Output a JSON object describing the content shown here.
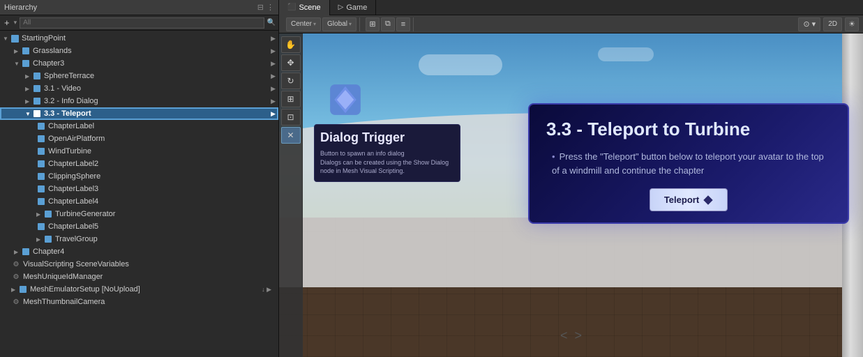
{
  "hierarchy": {
    "panel_title": "Hierarchy",
    "search_placeholder": "All",
    "tree": [
      {
        "id": "starting-point",
        "label": "StartingPoint",
        "level": 0,
        "expanded": true,
        "type": "root",
        "icon": "cube"
      },
      {
        "id": "grasslands",
        "label": "Grasslands",
        "level": 1,
        "expanded": false,
        "type": "cube",
        "icon": "cube"
      },
      {
        "id": "chapter3",
        "label": "Chapter3",
        "level": 1,
        "expanded": true,
        "type": "cube",
        "icon": "cube"
      },
      {
        "id": "sphere-terrace",
        "label": "SphereTerrace",
        "level": 2,
        "expanded": false,
        "type": "cube",
        "icon": "cube"
      },
      {
        "id": "video",
        "label": "3.1 - Video",
        "level": 2,
        "expanded": false,
        "type": "cube",
        "icon": "cube"
      },
      {
        "id": "info-dialog",
        "label": "3.2 - Info Dialog",
        "level": 2,
        "expanded": false,
        "type": "cube",
        "icon": "cube"
      },
      {
        "id": "teleport",
        "label": "3.3 - Teleport",
        "level": 2,
        "expanded": true,
        "type": "cube",
        "icon": "cube",
        "selected": true
      },
      {
        "id": "chapter-label",
        "label": "ChapterLabel",
        "level": 3,
        "expanded": false,
        "type": "cube",
        "icon": "cube"
      },
      {
        "id": "open-air-platform",
        "label": "OpenAirPlatform",
        "level": 3,
        "expanded": false,
        "type": "cube",
        "icon": "cube"
      },
      {
        "id": "wind-turbine",
        "label": "WindTurbine",
        "level": 3,
        "expanded": false,
        "type": "cube",
        "icon": "cube"
      },
      {
        "id": "chapter-label2",
        "label": "ChapterLabel2",
        "level": 3,
        "expanded": false,
        "type": "cube",
        "icon": "cube"
      },
      {
        "id": "clipping-sphere",
        "label": "ClippingSphere",
        "level": 3,
        "expanded": false,
        "type": "cube",
        "icon": "cube"
      },
      {
        "id": "chapter-label3",
        "label": "ChapterLabel3",
        "level": 3,
        "expanded": false,
        "type": "cube",
        "icon": "cube"
      },
      {
        "id": "chapter-label4",
        "label": "ChapterLabel4",
        "level": 3,
        "expanded": false,
        "type": "cube",
        "icon": "cube"
      },
      {
        "id": "turbine-generator",
        "label": "TurbineGenerator",
        "level": 3,
        "expanded": false,
        "type": "cube",
        "icon": "cube"
      },
      {
        "id": "chapter-label5",
        "label": "ChapterLabel5",
        "level": 3,
        "expanded": false,
        "type": "cube",
        "icon": "cube"
      },
      {
        "id": "travel-group",
        "label": "TravelGroup",
        "level": 3,
        "expanded": false,
        "type": "cube",
        "icon": "cube"
      },
      {
        "id": "chapter4",
        "label": "Chapter4",
        "level": 1,
        "expanded": false,
        "type": "cube",
        "icon": "cube"
      },
      {
        "id": "visual-scripting",
        "label": "VisualScripting SceneVariables",
        "level": 1,
        "expanded": false,
        "type": "gear",
        "icon": "gear"
      },
      {
        "id": "mesh-unique",
        "label": "MeshUniqueIdManager",
        "level": 1,
        "expanded": false,
        "type": "gear",
        "icon": "gear"
      },
      {
        "id": "mesh-emulator",
        "label": "MeshEmulatorSetup [NoUpload]",
        "level": 1,
        "expanded": false,
        "type": "cube",
        "icon": "cube"
      },
      {
        "id": "mesh-thumbnail",
        "label": "MeshThumbnailCamera",
        "level": 1,
        "expanded": false,
        "type": "gear",
        "icon": "gear"
      }
    ]
  },
  "scene_tab": {
    "label": "Scene",
    "icon": "scene"
  },
  "game_tab": {
    "label": "Game",
    "icon": "game"
  },
  "toolbar": {
    "center_label": "Center",
    "center_arrow": "▾",
    "global_label": "Global",
    "global_arrow": "▾",
    "view_2d": "2D",
    "view_light": "☀"
  },
  "tools": [
    {
      "id": "hand",
      "icon": "✋",
      "active": false
    },
    {
      "id": "move",
      "icon": "✥",
      "active": false
    },
    {
      "id": "rotate",
      "icon": "↻",
      "active": false
    },
    {
      "id": "scale",
      "icon": "⊞",
      "active": false
    },
    {
      "id": "rect",
      "icon": "⊡",
      "active": false
    },
    {
      "id": "transform",
      "icon": "✕",
      "active": true
    }
  ],
  "dialog_trigger": {
    "title": "Dialog Trigger",
    "line1": "Button to spawn an info dialog",
    "line2": "Dialogs can be created using the Show Dialog node in Mesh Visual Scripting."
  },
  "teleport_panel": {
    "title": "3.3 - Teleport to Turbine",
    "description": "Press the \"Teleport\" button below to teleport your avatar to the top of a windmill and continue the chapter",
    "button_label": "Teleport"
  },
  "nav": {
    "back_icon": "<",
    "forward_icon": ">"
  },
  "colors": {
    "selected_bg": "#2c5f8a",
    "teleport_panel_bg": "#0a0a3a",
    "dialog_panel_bg": "#1a1a3a",
    "hierarchy_bg": "#2b2b2b"
  }
}
